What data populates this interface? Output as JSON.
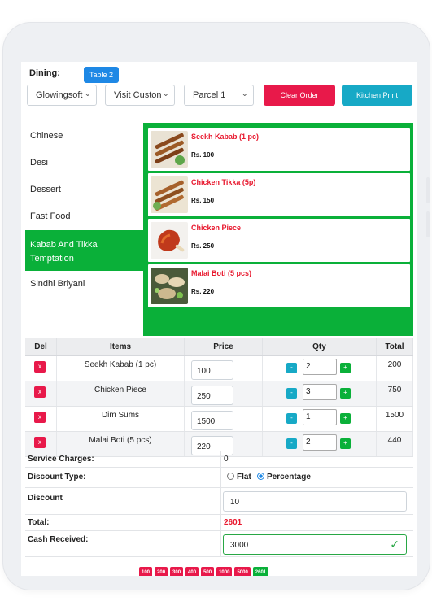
{
  "header": {
    "dining_label": "Dining:",
    "table_badge": "Table 2",
    "customer_select": "Glowingsoft",
    "visit_select": "Visit Custon",
    "parcel_select": "Parcel 1",
    "clear_order": "Clear Order",
    "kitchen_print": "Kitchen Print"
  },
  "categories": [
    "Chinese",
    "Desi",
    "Dessert",
    "Fast Food",
    "Kabab And Tikka Temptation",
    "Sindhi Briyani"
  ],
  "menu_items": [
    {
      "name": "Seekh Kabab (1 pc)",
      "price": "Rs. 100"
    },
    {
      "name": "Chicken Tikka (5p)",
      "price": "Rs. 150"
    },
    {
      "name": "Chicken Piece",
      "price": "Rs. 250"
    },
    {
      "name": "Malai Boti (5 pcs)",
      "price": "Rs. 220"
    }
  ],
  "order_table": {
    "headers": {
      "del": "Del",
      "items": "Items",
      "price": "Price",
      "qty": "Qty",
      "total": "Total"
    },
    "del_symbol": "x",
    "minus_symbol": "-",
    "plus_symbol": "+",
    "rows": [
      {
        "item": "Seekh Kabab (1 pc)",
        "price": "100",
        "qty": "2",
        "total": "200"
      },
      {
        "item": "Chicken Piece",
        "price": "250",
        "qty": "3",
        "total": "750"
      },
      {
        "item": "Dim Sums",
        "price": "1500",
        "qty": "1",
        "total": "1500"
      },
      {
        "item": "Malai Boti (5 pcs)",
        "price": "220",
        "qty": "2",
        "total": "440"
      }
    ]
  },
  "summary": {
    "service_label": "Service Charges:",
    "service_value": "0",
    "discount_type_label": "Discount Type:",
    "flat_label": "Flat",
    "percentage_label": "Percentage",
    "discount_type_selected": "Percentage",
    "discount_label": "Discount",
    "discount_value": "10",
    "total_label": "Total:",
    "total_value": "2601",
    "cash_label": "Cash Received:",
    "cash_value": "3000"
  },
  "quick_cash": [
    "100",
    "200",
    "300",
    "400",
    "500",
    "1000",
    "5000",
    "2601"
  ],
  "colors": {
    "accent_green": "#0ab039",
    "accent_red": "#e8194a",
    "accent_teal": "#17a9c6",
    "badge_blue": "#1e88e5"
  }
}
